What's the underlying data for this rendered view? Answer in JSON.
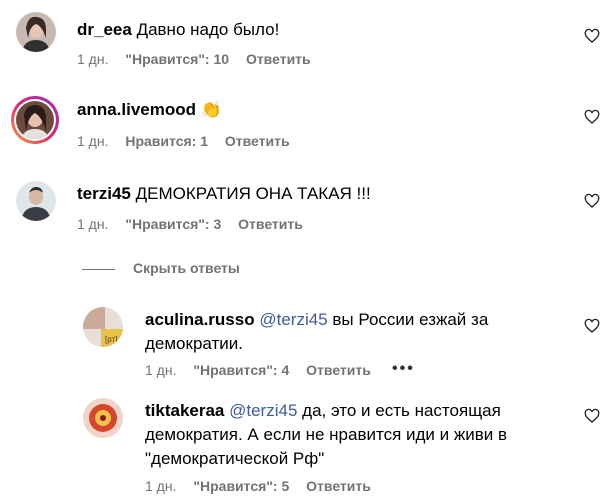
{
  "comments": [
    {
      "username": "dr_eea",
      "text": "Давно надо было!",
      "time": "1 дн.",
      "likes": "\"Нравится\": 10",
      "reply": "Ответить"
    },
    {
      "username": "anna.livemood",
      "text": "",
      "emoji": "👏",
      "time": "1 дн.",
      "likes": "Нравится: 1",
      "reply": "Ответить"
    },
    {
      "username": "terzi45",
      "text": "ДЕМОКРАТИЯ ОНА ТАКАЯ !!!",
      "time": "1 дн.",
      "likes": "\"Нравится\": 3",
      "reply": "Ответить"
    }
  ],
  "hide_replies": "Скрыть ответы",
  "replies": [
    {
      "username": "aculina.russo",
      "mention": "@terzi45",
      "text_line1": "вы России езжай за",
      "text_line2": "демократии.",
      "time": "1 дн.",
      "likes": "\"Нравится\": 4",
      "reply": "Ответить",
      "more": "•••"
    },
    {
      "username": "tiktakeraa",
      "mention": "@terzi45",
      "text_line1": "да, это и есть настоящая",
      "text_line2": "демократия. А если не нравится иди и живи в",
      "text_line3": "\"демократической Рф\"",
      "time": "1 дн.",
      "likes": "\"Нравится\": 5",
      "reply": "Ответить"
    }
  ],
  "avatar_text": "[рт]"
}
